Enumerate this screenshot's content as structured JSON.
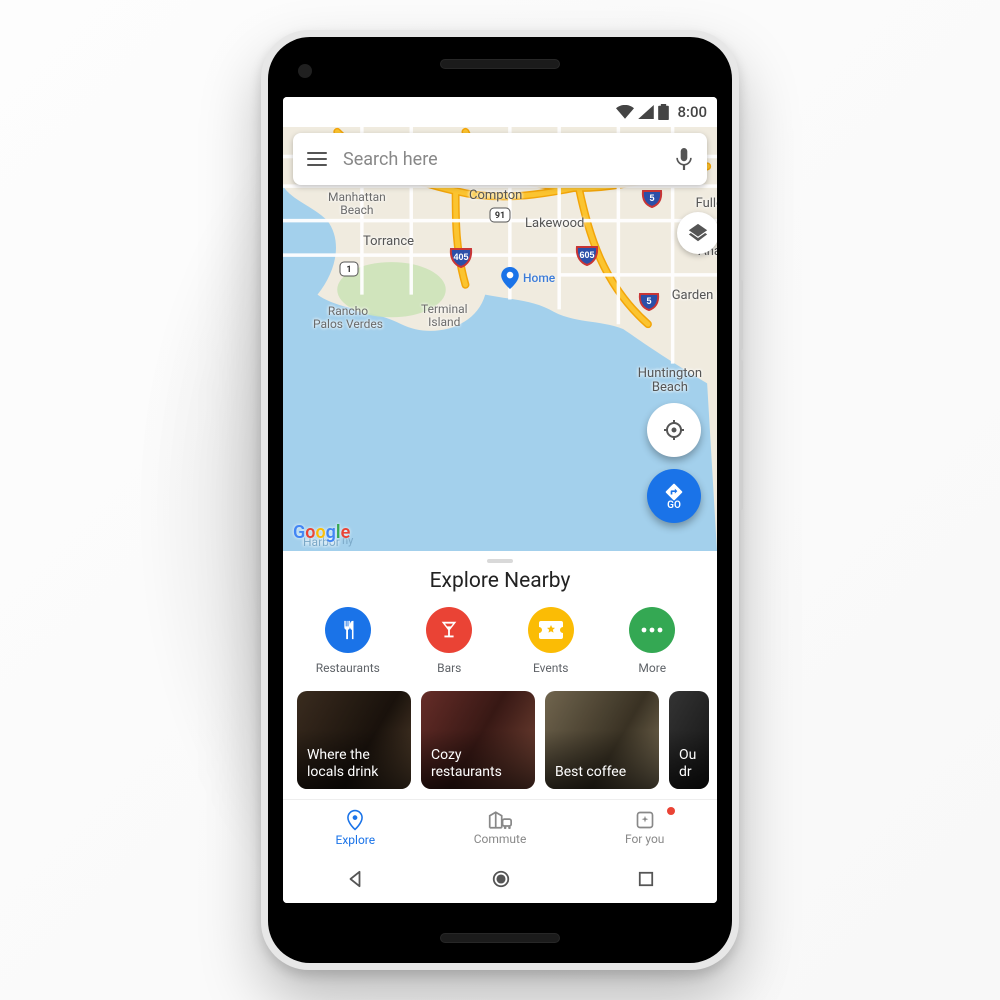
{
  "statusbar": {
    "time": "8:00"
  },
  "search": {
    "placeholder": "Search here"
  },
  "go_button": {
    "label": "GO"
  },
  "home_pin": {
    "label": "Home"
  },
  "logo": {
    "text": "Google"
  },
  "map_labels": {
    "manhattan_beach": "Manhattan\nBeach",
    "torrance": "Torrance",
    "compton": "Compton",
    "lakewood": "Lakewood",
    "rancho_pv": "Rancho\nPalos Verdes",
    "terminal_island": "Terminal\nIsland",
    "fullerton": "Fulle",
    "anaheim": "Ana",
    "garden_grove": "Garden (",
    "huntington_beach": "Huntington\nBeach",
    "harbor": "Harbor"
  },
  "route_shields": {
    "i405": "405",
    "i605": "605",
    "i5a": "5",
    "i5b": "5",
    "ca91": "91",
    "ca1": "1"
  },
  "sheet": {
    "title": "Explore Nearby",
    "categories": [
      {
        "label": "Restaurants",
        "icon": "restaurant",
        "color": "#1a73e8"
      },
      {
        "label": "Bars",
        "icon": "bar",
        "color": "#ea4335"
      },
      {
        "label": "Events",
        "icon": "event",
        "color": "#fbbc05"
      },
      {
        "label": "More",
        "icon": "more",
        "color": "#34a853"
      }
    ],
    "cards": [
      {
        "title": "Where the locals drink"
      },
      {
        "title": "Cozy restaurants"
      },
      {
        "title": "Best coffee"
      },
      {
        "title": "Ou dr"
      }
    ]
  },
  "bottomnav": {
    "items": [
      {
        "label": "Explore",
        "icon": "pin",
        "active": true,
        "badge": false
      },
      {
        "label": "Commute",
        "icon": "commute",
        "active": false,
        "badge": false
      },
      {
        "label": "For you",
        "icon": "foryou",
        "active": false,
        "badge": true
      }
    ]
  }
}
